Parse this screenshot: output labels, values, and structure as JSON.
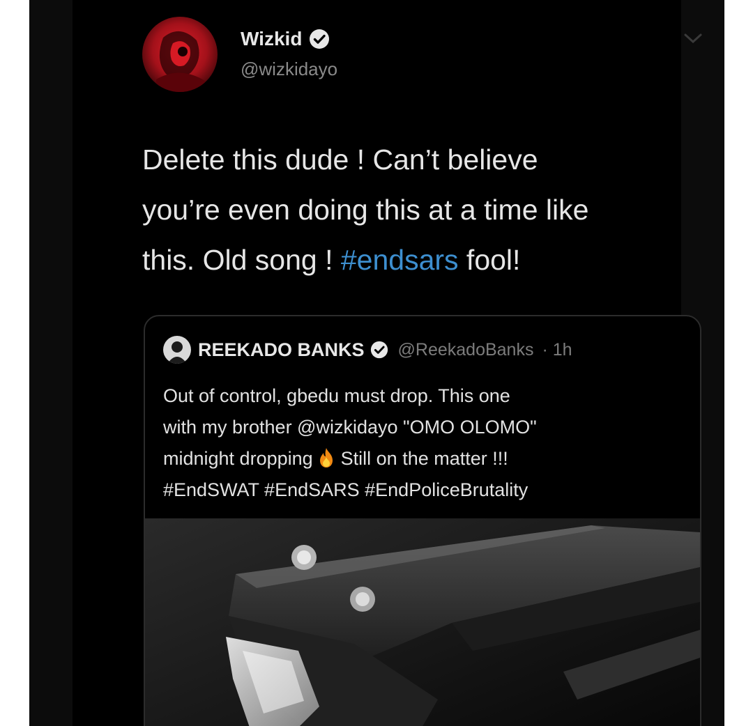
{
  "author": {
    "name": "Wizkid",
    "handle": "@wizkidayo"
  },
  "tweet": {
    "text_line1": "Delete this dude ! Can’t believe",
    "text_line2": "you’re even doing this at a time like",
    "text_line3_before": "this. Old song ! ",
    "hashtag": "#endsars",
    "text_line3_after": " fool!"
  },
  "quoted": {
    "name": "REEKADO BANKS",
    "handle": "@ReekadoBanks",
    "time": "· 1h",
    "line1": "Out of control, gbedu must drop. This one",
    "line2": "with my brother @wizkidayo \"OMO OLOMO\"",
    "line3_before": "midnight dropping",
    "line3_after": "Still on the matter !!!",
    "line4": "#EndSWAT #EndSARS #EndPoliceBrutality",
    "media_icon": "turntable-cartridge-image"
  },
  "icons": {
    "verified": "verified-badge-icon",
    "chevron": "chevron-down-icon",
    "fire": "fire-emoji-icon"
  },
  "colors": {
    "background": "#000000",
    "text": "#e6e6e6",
    "hashtag": "#3d8fd0",
    "muted": "#8a8a8a",
    "avatar_red": "#b0121a"
  }
}
